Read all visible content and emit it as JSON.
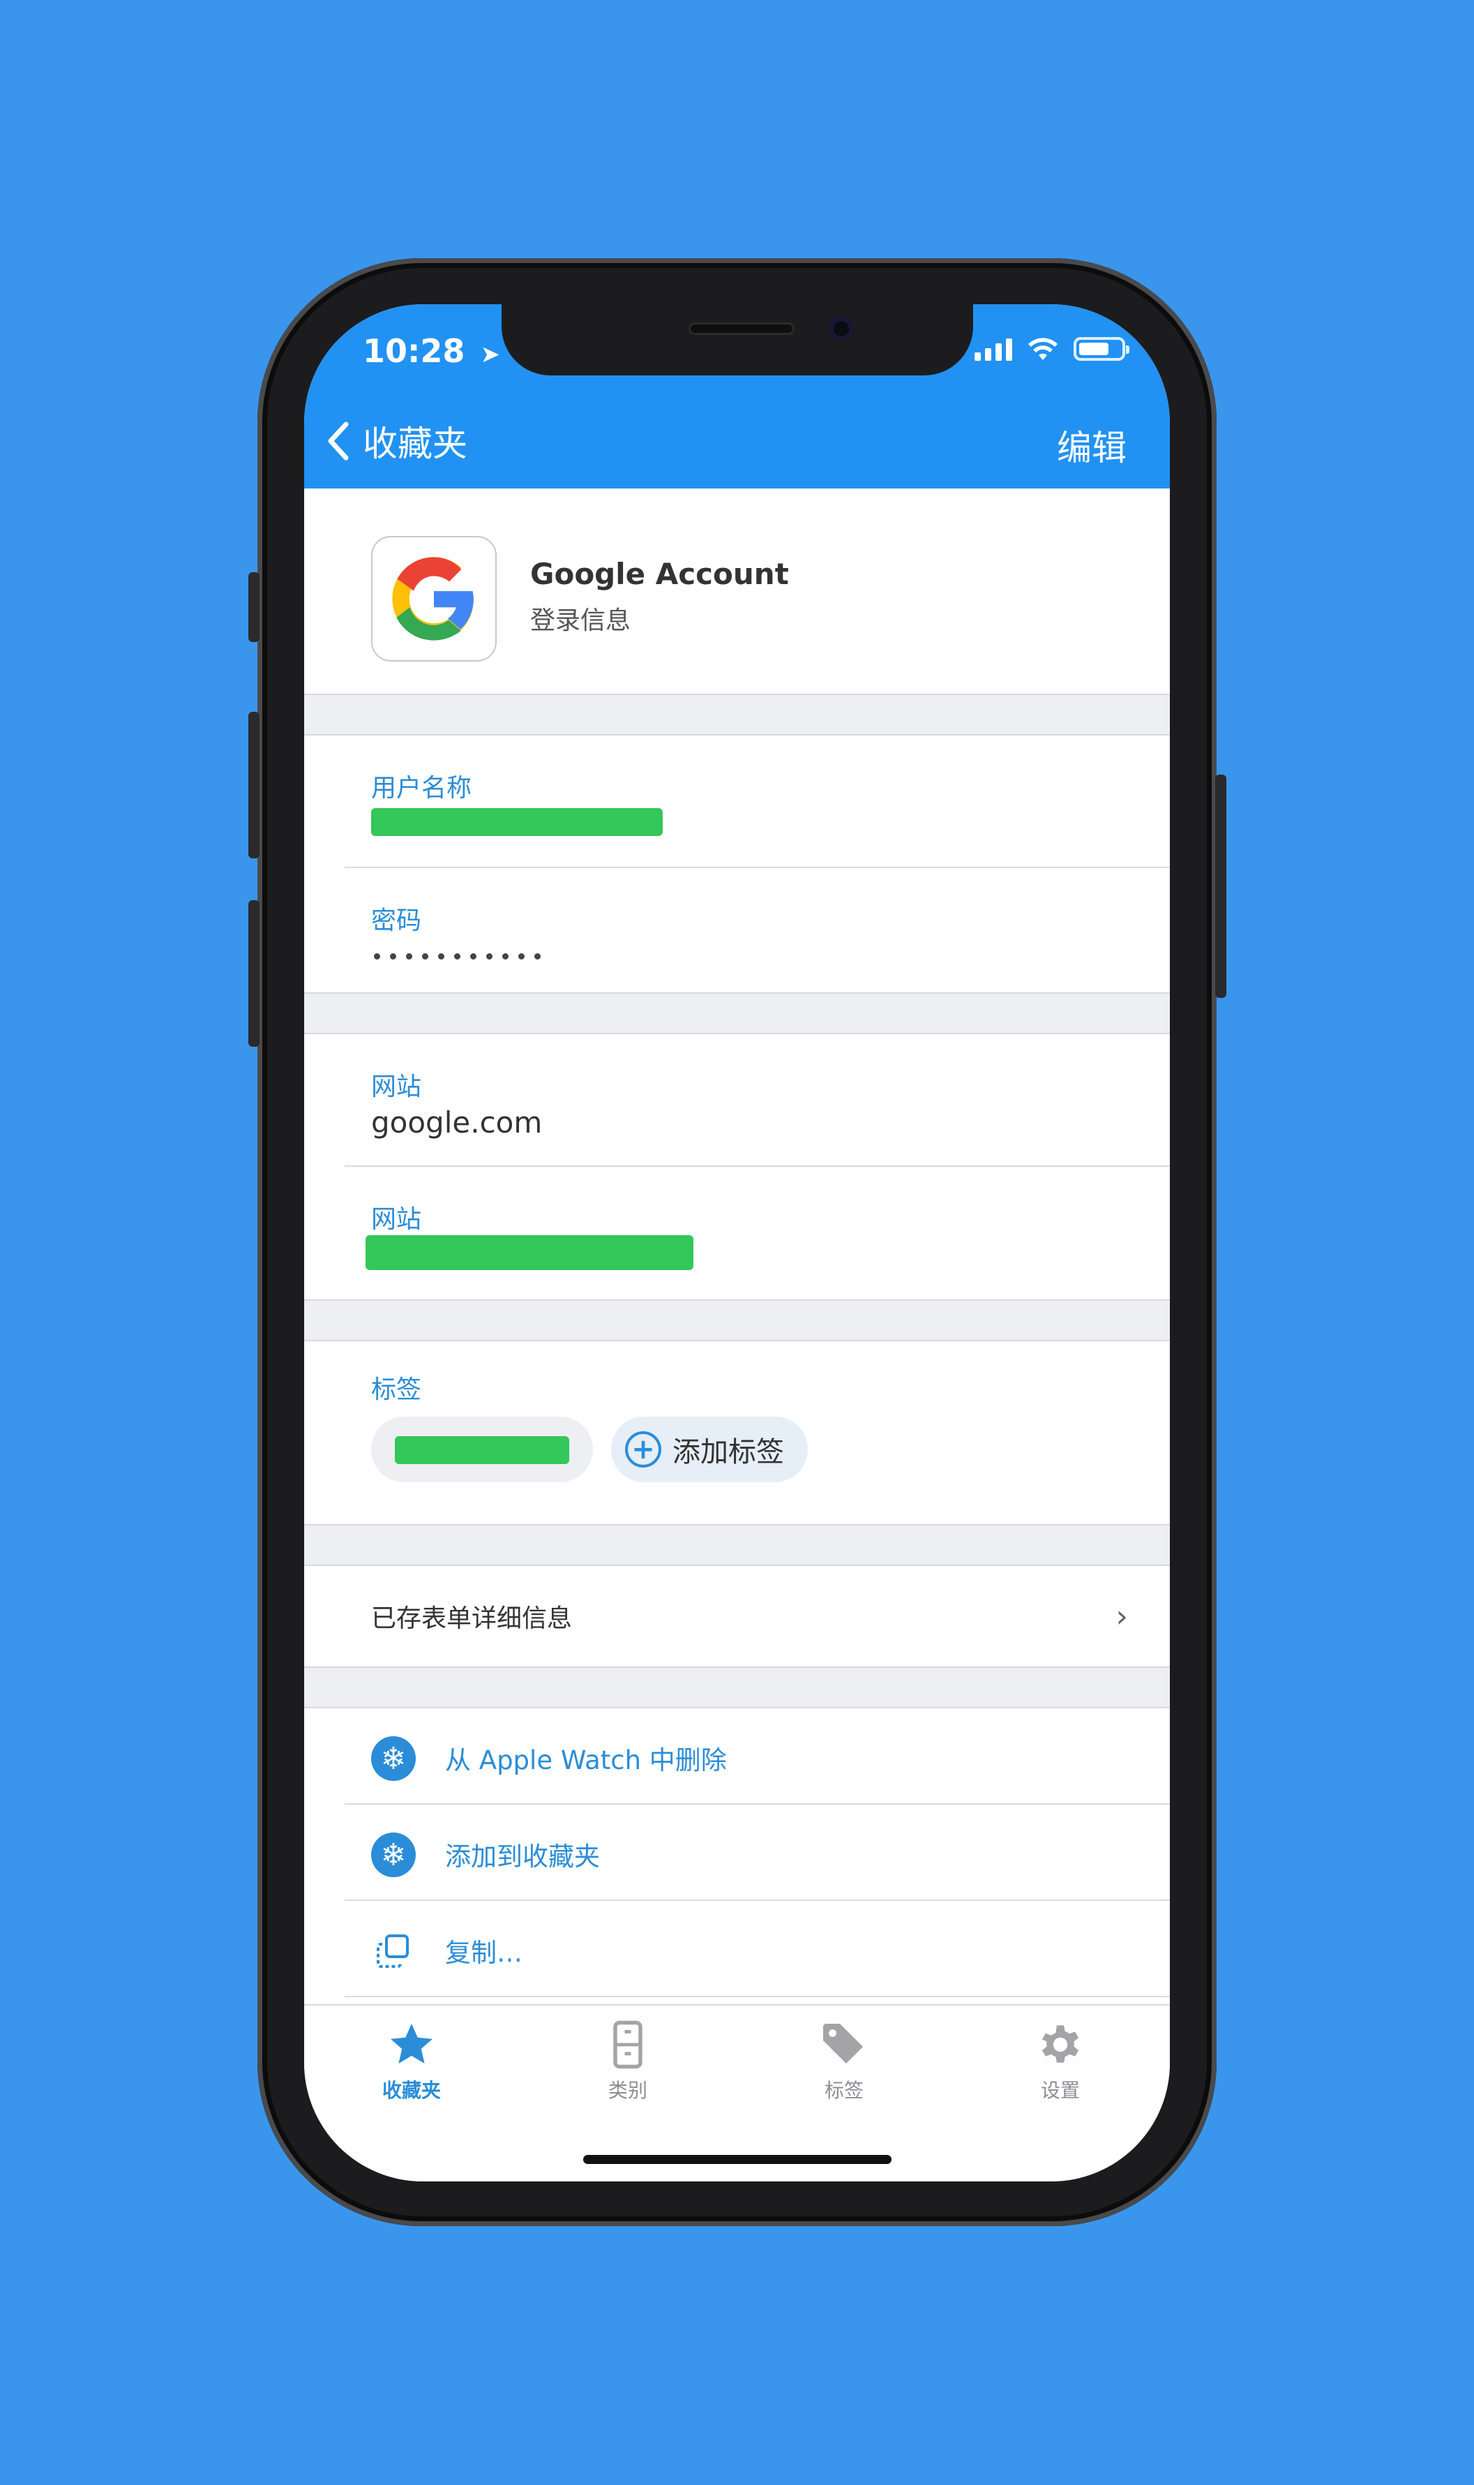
{
  "status": {
    "time": "10:28"
  },
  "nav": {
    "back_label": "收藏夹",
    "edit_label": "编辑"
  },
  "item": {
    "title": "Google Account",
    "subtitle": "登录信息"
  },
  "fields": {
    "username_label": "用户名称",
    "password_label": "密码",
    "password_dots": 11,
    "website1_label": "网站",
    "website1_value": "google.com",
    "website2_label": "网站",
    "tags_label": "标签",
    "add_tag_label": "添加标签"
  },
  "saved_form": {
    "label": "已存表单详细信息"
  },
  "actions": [
    {
      "label": "从 Apple Watch 中删除",
      "icon": "snowflake-icon"
    },
    {
      "label": "添加到收藏夹",
      "icon": "snowflake-icon"
    },
    {
      "label": "复制…",
      "icon": "copy-icon"
    }
  ],
  "tabs": [
    {
      "label": "收藏夹",
      "icon": "star-icon",
      "active": true
    },
    {
      "label": "类别",
      "icon": "cabinet-icon",
      "active": false
    },
    {
      "label": "标签",
      "icon": "tag-icon",
      "active": false
    },
    {
      "label": "设置",
      "icon": "gear-icon",
      "active": false
    }
  ],
  "colors": {
    "background": "#3A96EC",
    "header": "#2192F3",
    "accent": "#2B8DD8",
    "redaction": "#34C759"
  }
}
